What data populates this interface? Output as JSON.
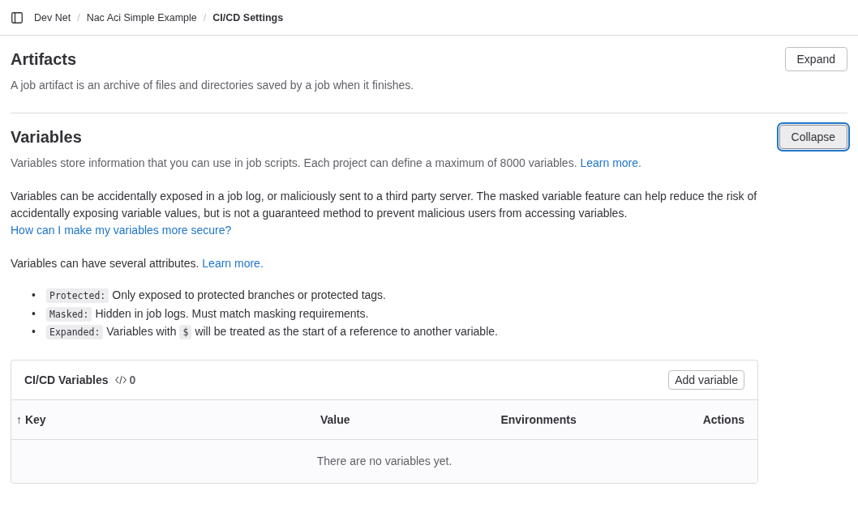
{
  "breadcrumb": [
    {
      "label": "Dev Net",
      "current": false
    },
    {
      "label": "Nac Aci Simple Example",
      "current": false
    },
    {
      "label": "CI/CD Settings",
      "current": true
    }
  ],
  "breadcrumb_separator": "/",
  "sections": [
    {
      "title": "Artifacts",
      "button": "Expand",
      "expanded": false,
      "description": "A job artifact is an archive of files and directories saved by a job when it finishes."
    },
    {
      "title": "Variables",
      "button": "Collapse",
      "expanded": true,
      "description": "Variables store information that you can use in job scripts. Each project can define a maximum of 8000 variables.",
      "description_link": "Learn more."
    }
  ],
  "paragraphs": [
    {
      "text": "Variables can be accidentally exposed in a job log, or maliciously sent to a third party server. The masked variable feature can help reduce the risk of accidentally exposing variable values, but is not a guaranteed method to prevent malicious users from accessing variables.",
      "link": "How can I make my variables more secure?"
    },
    {
      "text": "Variables can have several attributes.",
      "link": "Learn more."
    }
  ],
  "attributes": [
    {
      "marker": "•",
      "segments": [
        {
          "kind": "code",
          "text": "Protected:"
        },
        {
          "kind": "text",
          "text": "Only exposed to protected branches or protected tags."
        }
      ]
    },
    {
      "marker": "•",
      "segments": [
        {
          "kind": "code",
          "text": "Masked:"
        },
        {
          "kind": "text",
          "text": "Hidden in job logs. Must match masking requirements."
        }
      ]
    },
    {
      "marker": "•",
      "segments": [
        {
          "kind": "code",
          "text": "Expanded:"
        },
        {
          "kind": "text",
          "text": "Variables with"
        },
        {
          "kind": "code",
          "text": "$"
        },
        {
          "kind": "text",
          "text": "will be treated as the start of a reference to another variable."
        }
      ]
    }
  ],
  "variables_card": {
    "title": "CI/CD Variables",
    "count": "0",
    "add_button": "Add variable",
    "columns": [
      {
        "label": "Key",
        "sort": "↑"
      },
      {
        "label": "Value"
      },
      {
        "label": "Environments"
      },
      {
        "label": "Actions"
      }
    ],
    "empty_message": "There are no variables yet."
  }
}
